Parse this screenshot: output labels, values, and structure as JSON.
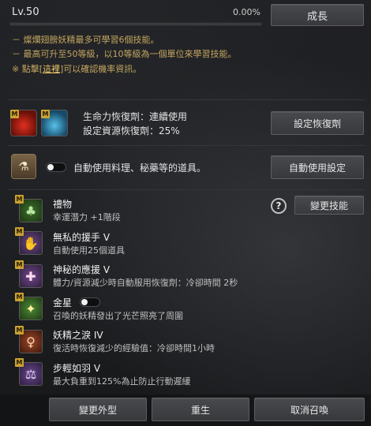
{
  "header": {
    "level": "Lv.50",
    "progress_text": "0.00%",
    "progress": 0.0,
    "grow_button": "成長"
  },
  "info_lines": {
    "line1": "－ 燦爛翅膀妖精最多可學習6個技能。",
    "line2": "－ 最高可升至50等級，以10等級為一個單位來學習技能。",
    "line3_prefix": "※ 點擊[",
    "line3_link": "這裡",
    "line3_suffix": "]可以確認機率資訊。"
  },
  "potion_section": {
    "line1": "生命力恢復劑：連續使用",
    "line2": "設定資源恢復劑：25%",
    "set_button": "設定恢復劑"
  },
  "auto_use": {
    "label": "自動使用料理、秘藥等的道具。",
    "toggle_on": false,
    "settings_button": "自動使用設定"
  },
  "skills_panel": {
    "change_skill_button": "變更技能",
    "help_icon": "?"
  },
  "skills": [
    {
      "name": "禮物",
      "desc": "幸運潛力 +1階段",
      "icon": "clover-icon",
      "color": "#2a4a1f",
      "has_toggle": false
    },
    {
      "name": "無私的援手 V",
      "desc": "自動使用25個道具",
      "icon": "fairy-hand-icon",
      "color": "#4a2f55",
      "has_toggle": false
    },
    {
      "name": "神秘的應援 V",
      "desc": "體力/資源減少時自動服用恢復劑：冷卻時間 2秒",
      "icon": "potion-cheer-icon",
      "color": "#4f3259",
      "has_toggle": false
    },
    {
      "name": "金星",
      "desc": "召喚的妖精發出了光芒照亮了周圍",
      "icon": "lantern-icon",
      "color": "#2f5220",
      "has_toggle": true
    },
    {
      "name": "妖精之淚 IV",
      "desc": "復活時恢復減少的經驗值：冷卻時間1小時",
      "icon": "tear-icon",
      "color": "#6a2f1e",
      "has_toggle": false
    },
    {
      "name": "步輕如羽 V",
      "desc": "最大負重到125%為止防止行動遲緩",
      "icon": "feather-weight-icon",
      "color": "#4a3060",
      "has_toggle": false
    }
  ],
  "footer": {
    "appearance_button": "變更外型",
    "rebirth_button": "重生",
    "dismiss_button": "取消召喚"
  },
  "badge_letter": "M"
}
